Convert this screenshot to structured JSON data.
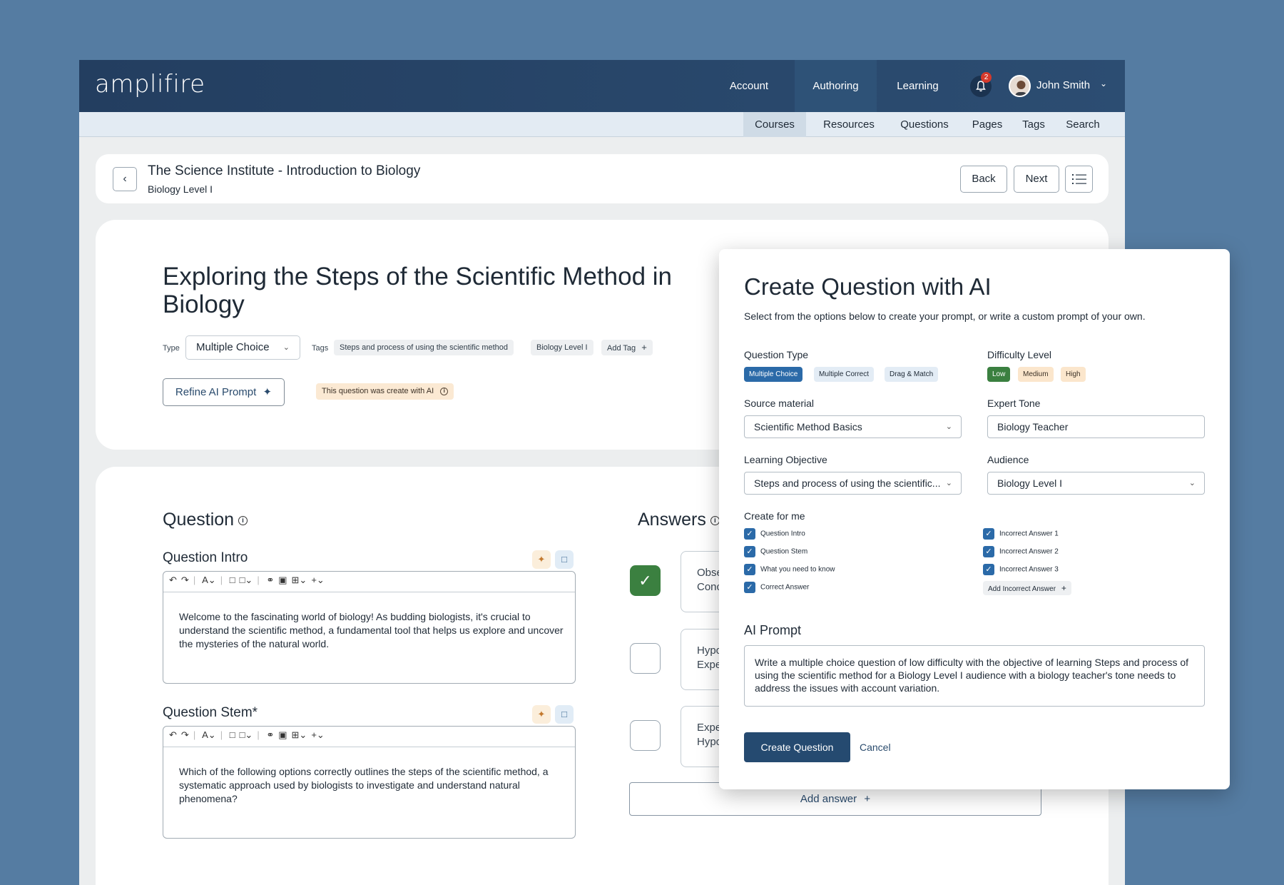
{
  "app": {
    "logo": "amplifire",
    "topnav": [
      {
        "label": "Account"
      },
      {
        "label": "Authoring"
      },
      {
        "label": "Learning"
      }
    ],
    "notifications_count": "2",
    "user_name": "John Smith",
    "subnav": [
      {
        "label": "Courses"
      },
      {
        "label": "Resources"
      },
      {
        "label": "Questions"
      },
      {
        "label": "Pages"
      },
      {
        "label": "Tags"
      },
      {
        "label": "Search"
      }
    ]
  },
  "header": {
    "course_title": "The Science Institute - Introduction to Biology",
    "course_subtitle": "Biology Level I",
    "back_label": "Back",
    "next_label": "Next"
  },
  "question_meta": {
    "title": "Exploring the Steps of the Scientific Method in Biology",
    "type_label": "Type",
    "type_value": "Multiple Choice",
    "tags_label": "Tags",
    "tags": [
      "Steps and process of using the scientific method",
      "Biology Level I"
    ],
    "add_tag_label": "Add Tag",
    "refine_label": "Refine AI Prompt",
    "ai_note": "This question was create with AI"
  },
  "question": {
    "heading": "Question",
    "intro_label": "Question Intro",
    "intro_text": "Welcome to the fascinating world of biology! As budding biologists, it's crucial to understand the scientific method, a fundamental tool that helps us explore and uncover the mysteries of the natural world.",
    "stem_label": "Question Stem*",
    "stem_text": "Which of the following options correctly outlines the steps of the scientific method, a systematic approach used by biologists to investigate and understand natural phenomena?"
  },
  "answers": {
    "heading": "Answers",
    "items": [
      {
        "line1": "Obse",
        "line2": "Conc",
        "correct": true
      },
      {
        "line1": "Hypo",
        "line2": "Expe",
        "correct": false
      },
      {
        "line1": "Expe",
        "line2": "Hypo",
        "correct": false
      }
    ],
    "add_label": "Add answer"
  },
  "modal": {
    "title": "Create Question with AI",
    "description": "Select from the options below to create your prompt, or write a custom prompt of your own.",
    "question_type_label": "Question Type",
    "question_types": [
      "Multiple Choice",
      "Multiple Correct",
      "Drag & Match"
    ],
    "difficulty_label": "Difficulty Level",
    "difficulties": [
      "Low",
      "Medium",
      "High"
    ],
    "source_label": "Source material",
    "source_value": "Scientific Method Basics",
    "tone_label": "Expert Tone",
    "tone_value": "Biology Teacher",
    "objective_label": "Learning Objective",
    "objective_value": "Steps and process of using the scientific...",
    "audience_label": "Audience",
    "audience_value": "Biology Level I",
    "create_for_label": "Create for me",
    "create_left": [
      "Question Intro",
      "Question Stem",
      "What you need to know",
      "Correct Answer"
    ],
    "create_right": [
      "Incorrect Answer 1",
      "Incorrect Answer 2",
      "Incorrect Answer 3"
    ],
    "add_incorrect_label": "Add Incorrect Answer",
    "prompt_label": "AI Prompt",
    "prompt_text": "Write a multiple choice question of low difficulty with the objective of learning Steps and process of using the scientific method for a Biology Level I audience with a biology teacher's tone needs to address the issues with account variation.",
    "create_label": "Create Question",
    "cancel_label": "Cancel"
  }
}
